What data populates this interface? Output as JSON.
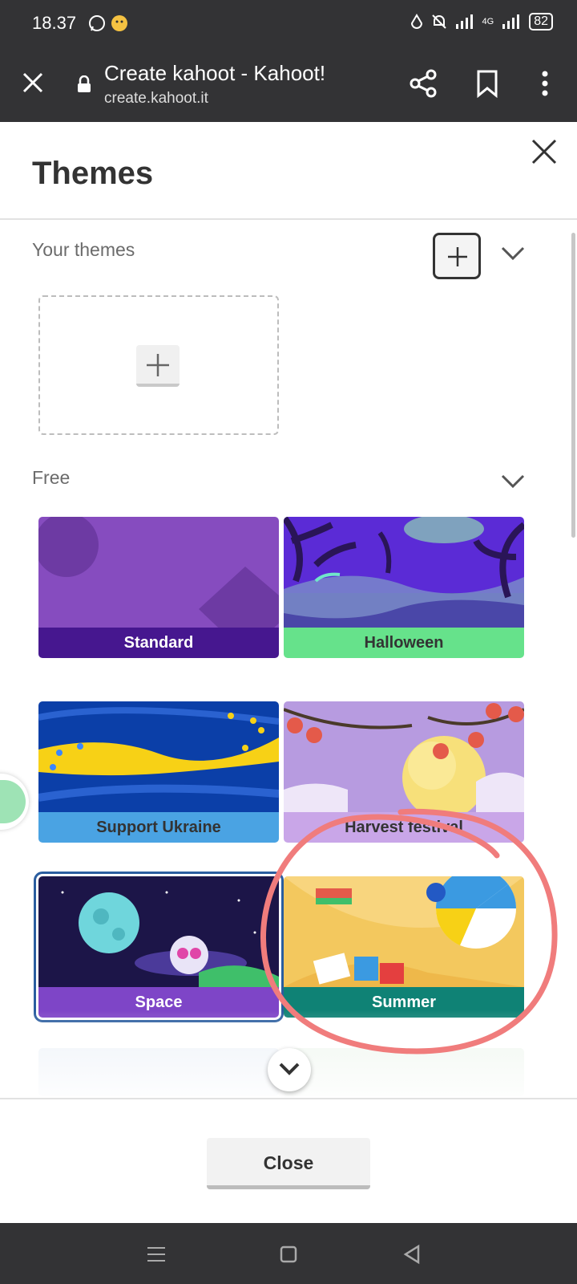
{
  "status_bar": {
    "time": "18.37",
    "network": "4G",
    "battery": "82"
  },
  "browser": {
    "page_title": "Create kahoot - Kahoot!",
    "url": "create.kahoot.it"
  },
  "dialog": {
    "title": "Themes",
    "your_themes_label": "Your themes",
    "free_label": "Free",
    "close_label": "Close"
  },
  "themes": [
    {
      "name": "Standard",
      "label_bg": "#46178f",
      "art_bg": "#864cbf"
    },
    {
      "name": "Halloween",
      "label_bg": "#66e28b",
      "art_bg": "#5b2bd6"
    },
    {
      "name": "Support Ukraine",
      "label_bg": "#4aa3e3",
      "art_bg": "#0b3fa8"
    },
    {
      "name": "Harvest festival",
      "label_bg": "#c9a6e8",
      "art_bg": "#b79be0"
    },
    {
      "name": "Space",
      "label_bg": "#7e45c7",
      "art_bg": "#1c1548",
      "selected": true
    },
    {
      "name": "Summer",
      "label_bg": "#0f8275",
      "art_bg": "#f3c85e"
    }
  ],
  "colors": {
    "chrome_dark": "#333335",
    "annotation_circle": "#f07c7c"
  }
}
